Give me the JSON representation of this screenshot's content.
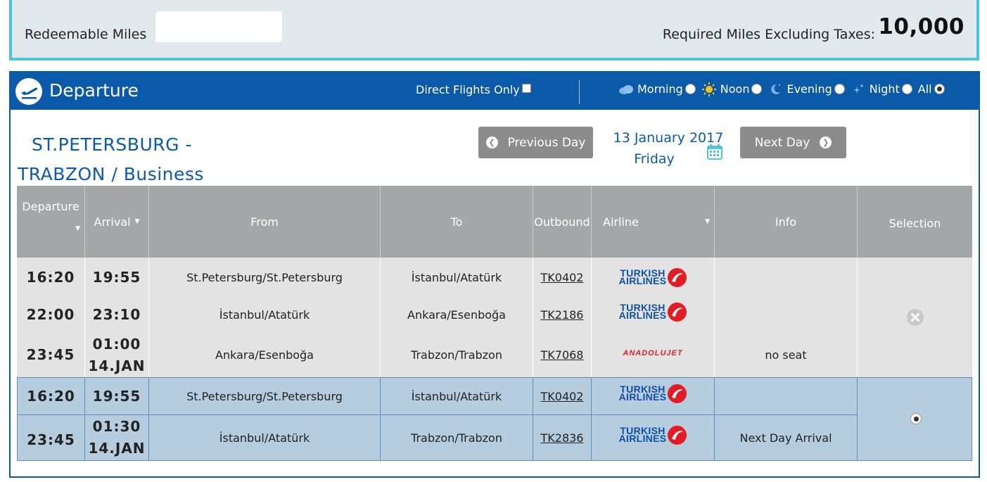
{
  "miles": {
    "redeemable_label": "Redeemable Miles",
    "required_label": "Required Miles Excluding Taxes:",
    "required_value": "10,000"
  },
  "header": {
    "title": "Departure",
    "direct_label": "Direct Flights Only",
    "time_options": [
      {
        "label": "Morning",
        "icon": "cloud-icon",
        "selected": false
      },
      {
        "label": "Noon",
        "icon": "sun-icon",
        "selected": false
      },
      {
        "label": "Evening",
        "icon": "moon-icon",
        "selected": false
      },
      {
        "label": "Night",
        "icon": "stars-icon",
        "selected": false
      },
      {
        "label": "All",
        "icon": "",
        "selected": true
      }
    ]
  },
  "route": {
    "line1": "ST.PETERSBURG -",
    "line2": "TRABZON / Business"
  },
  "nav": {
    "prev_label": "Previous Day",
    "next_label": "Next Day",
    "date": "13 January 2017",
    "weekday": "Friday"
  },
  "table": {
    "headers": {
      "departure": "Departure",
      "arrival": "Arrival",
      "from": "From",
      "to": "To",
      "outbound": "Outbound",
      "airline": "Airline",
      "info": "Info",
      "selection": "Selection"
    },
    "option1": {
      "rows": [
        {
          "dep": "16:20",
          "arr": "19:55",
          "arr2": "",
          "from": "St.Petersburg/St.Petersburg",
          "to": "İstanbul/Atatürk",
          "flight": "TK0402",
          "airline": "TURKISH AIRLINES",
          "info": ""
        },
        {
          "dep": "22:00",
          "arr": "23:10",
          "arr2": "",
          "from": "İstanbul/Atatürk",
          "to": "Ankara/Esenboğa",
          "flight": "TK2186",
          "airline": "TURKISH AIRLINES",
          "info": ""
        },
        {
          "dep": "23:45",
          "arr": "01:00",
          "arr2": "14.JAN",
          "from": "Ankara/Esenboğa",
          "to": "Trabzon/Trabzon",
          "flight": "TK7068",
          "airline": "ANADOLUJET",
          "info": "no seat"
        }
      ]
    },
    "option2": {
      "rows": [
        {
          "dep": "16:20",
          "arr": "19:55",
          "arr2": "",
          "from": "St.Petersburg/St.Petersburg",
          "to": "İstanbul/Atatürk",
          "flight": "TK0402",
          "airline": "TURKISH AIRLINES",
          "info": ""
        },
        {
          "dep": "23:45",
          "arr": "01:30",
          "arr2": "14.JAN",
          "from": "İstanbul/Atatürk",
          "to": "Trabzon/Trabzon",
          "flight": "TK2836",
          "airline": "TURKISH AIRLINES",
          "info": "Next Day Arrival"
        }
      ]
    }
  },
  "colors": {
    "header_blue": "#0b5aa9",
    "miles_border": "#4fc3d9",
    "selected_row": "#b6cddf",
    "unavailable_row": "#e3e3e3",
    "button_grey": "#8c8c8c"
  }
}
